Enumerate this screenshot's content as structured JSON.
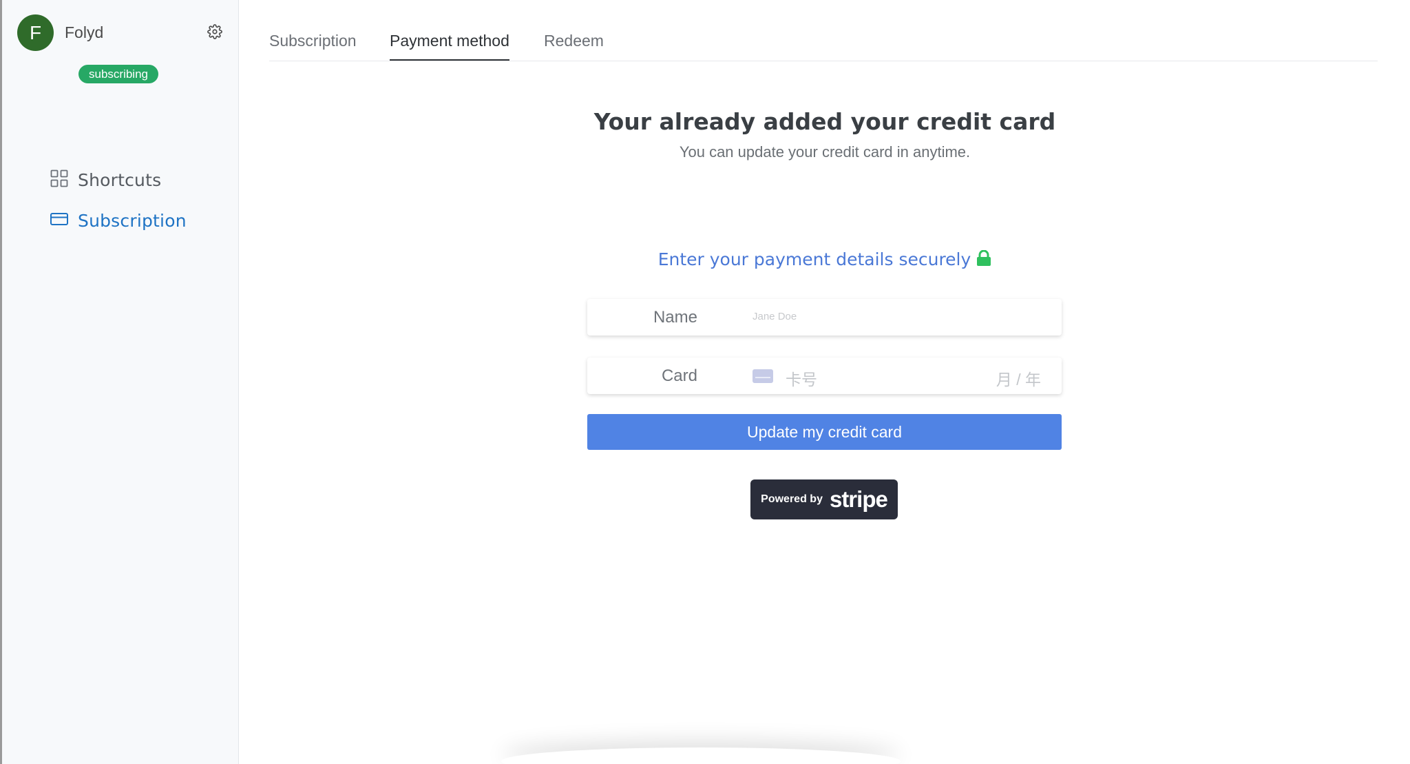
{
  "sidebar": {
    "avatar_letter": "F",
    "username": "Folyd",
    "status_badge": "subscribing",
    "items": [
      {
        "label": "Shortcuts",
        "icon": "grid-icon"
      },
      {
        "label": "Subscription",
        "icon": "credit-card-icon",
        "active": true
      }
    ]
  },
  "tabs": [
    {
      "label": "Subscription"
    },
    {
      "label": "Payment method",
      "active": true
    },
    {
      "label": "Redeem"
    }
  ],
  "main": {
    "heading": "Your already added your credit card",
    "subheading": "You can update your credit card in anytime.",
    "secure_title": "Enter your payment details securely",
    "name_label": "Name",
    "name_placeholder": "Jane Doe",
    "card_label": "Card",
    "card_number_placeholder": "卡号",
    "card_expiry_placeholder": "月 / 年",
    "update_button": "Update my credit card",
    "stripe_powered": "Powered by",
    "stripe_brand": "stripe"
  },
  "colors": {
    "accent": "#1e73c4",
    "button": "#5083e4",
    "badge": "#27a865",
    "lock": "#2fc05e",
    "secure_title": "#4a78d6"
  }
}
